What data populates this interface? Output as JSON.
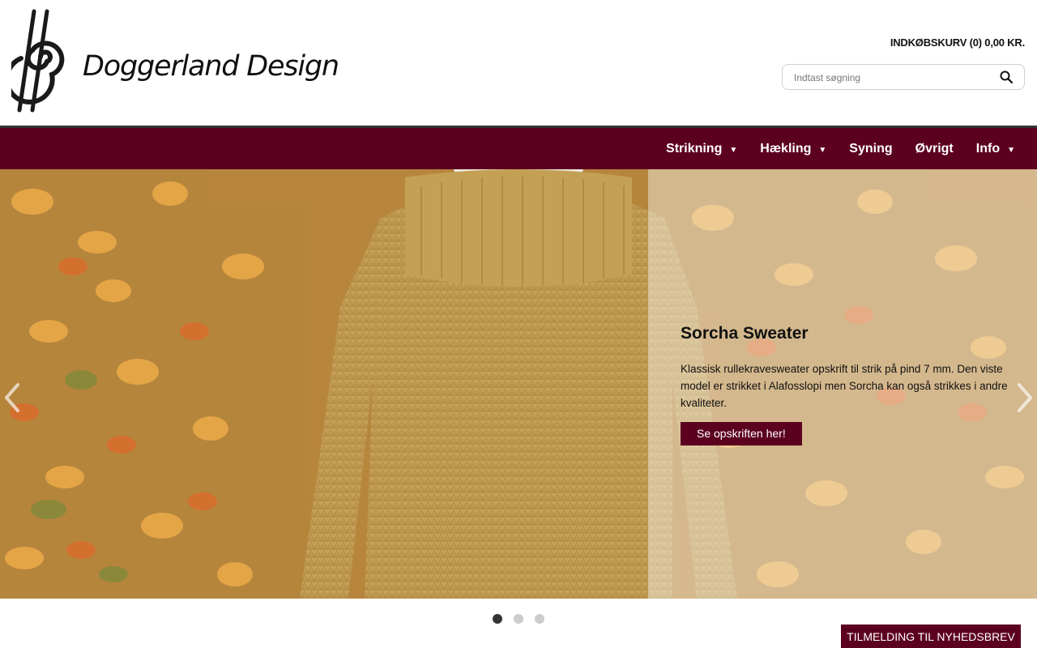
{
  "brand": {
    "name": "Doggerland Design"
  },
  "header": {
    "cart_label": "INDKØBSKURV (0) 0,00 KR.",
    "search_placeholder": "Indtast søgning",
    "search_icon": "search-icon"
  },
  "nav": {
    "items": [
      {
        "label": "Strikning",
        "has_dropdown": true
      },
      {
        "label": "Hækling",
        "has_dropdown": true
      },
      {
        "label": "Syning",
        "has_dropdown": false
      },
      {
        "label": "Øvrigt",
        "has_dropdown": false
      },
      {
        "label": "Info",
        "has_dropdown": true
      }
    ],
    "caret": "▼"
  },
  "slider": {
    "title": "Sorcha Sweater",
    "description": "Klassisk rullekravesweater opskrift til strik på pind 7 mm. Den viste model er strikket i Alafosslopi men Sorcha kan også strikkes i andre kvaliteter.",
    "button_label": "Se opskriften her!",
    "slide_count": 3,
    "active_slide": 1
  },
  "newsletter": {
    "label": "TILMELDING TIL NYHEDSBREV"
  },
  "colors": {
    "accent": "#5c0020",
    "nav_rule": "#333333"
  }
}
